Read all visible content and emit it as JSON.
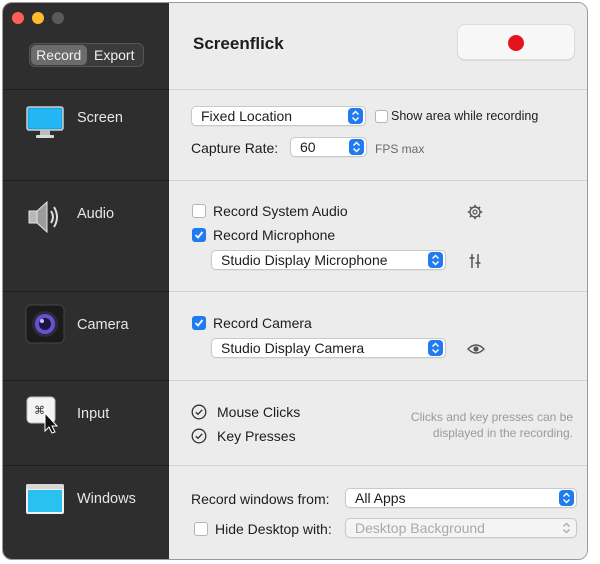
{
  "window": {
    "app_title": "Screenflick"
  },
  "mode_tabs": [
    "Record",
    "Export"
  ],
  "sidebar": [
    {
      "label": "Screen",
      "icon": "monitor-icon"
    },
    {
      "label": "Audio",
      "icon": "speaker-icon"
    },
    {
      "label": "Camera",
      "icon": "camera-icon"
    },
    {
      "label": "Input",
      "icon": "keyboard-cursor-icon"
    },
    {
      "label": "Windows",
      "icon": "windows-icon"
    }
  ],
  "screen": {
    "location_value": "Fixed Location",
    "show_area_label": "Show area while recording",
    "show_area_checked": false,
    "capture_rate_label": "Capture Rate:",
    "capture_rate_value": "60",
    "fps_label": "FPS max"
  },
  "audio": {
    "system_audio_label": "Record System Audio",
    "system_audio_checked": false,
    "microphone_label": "Record Microphone",
    "microphone_checked": true,
    "microphone_device": "Studio Display Microphone"
  },
  "camera": {
    "record_camera_label": "Record Camera",
    "record_camera_checked": true,
    "camera_device": "Studio Display Camera"
  },
  "input": {
    "mouse_clicks_label": "Mouse Clicks",
    "key_presses_label": "Key Presses",
    "note_line1": "Clicks and key presses can be",
    "note_line2": "displayed in the recording."
  },
  "windows": {
    "record_from_label": "Record windows from:",
    "record_from_value": "All Apps",
    "hide_desktop_label": "Hide Desktop with:",
    "hide_desktop_checked": false,
    "hide_desktop_value": "Desktop Background"
  },
  "colors": {
    "accent": "#1e7bf0",
    "record_red": "#e3141b",
    "sidebar_bg": "#2e2e2e",
    "panel_bg": "#ececec"
  }
}
